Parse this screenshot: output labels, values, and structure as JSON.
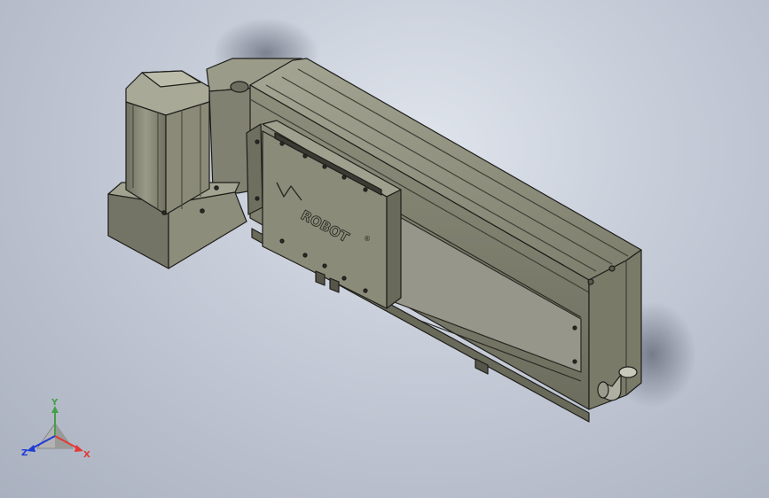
{
  "model": {
    "brand_logo_text": "ROBOT",
    "brand_mark": "®"
  },
  "triad": {
    "x_label": "X",
    "y_label": "Y",
    "z_label": "Z",
    "x_color": "#e53935",
    "y_color": "#43a047",
    "z_color": "#1e3ad6"
  },
  "colors": {
    "body": "#8a8a78",
    "body_dark": "#5f5f52",
    "body_light": "#a9a996",
    "edge": "#1d1d1a",
    "background": "#c4cad6"
  },
  "icons": [
    "coordinate-triad-icon"
  ]
}
